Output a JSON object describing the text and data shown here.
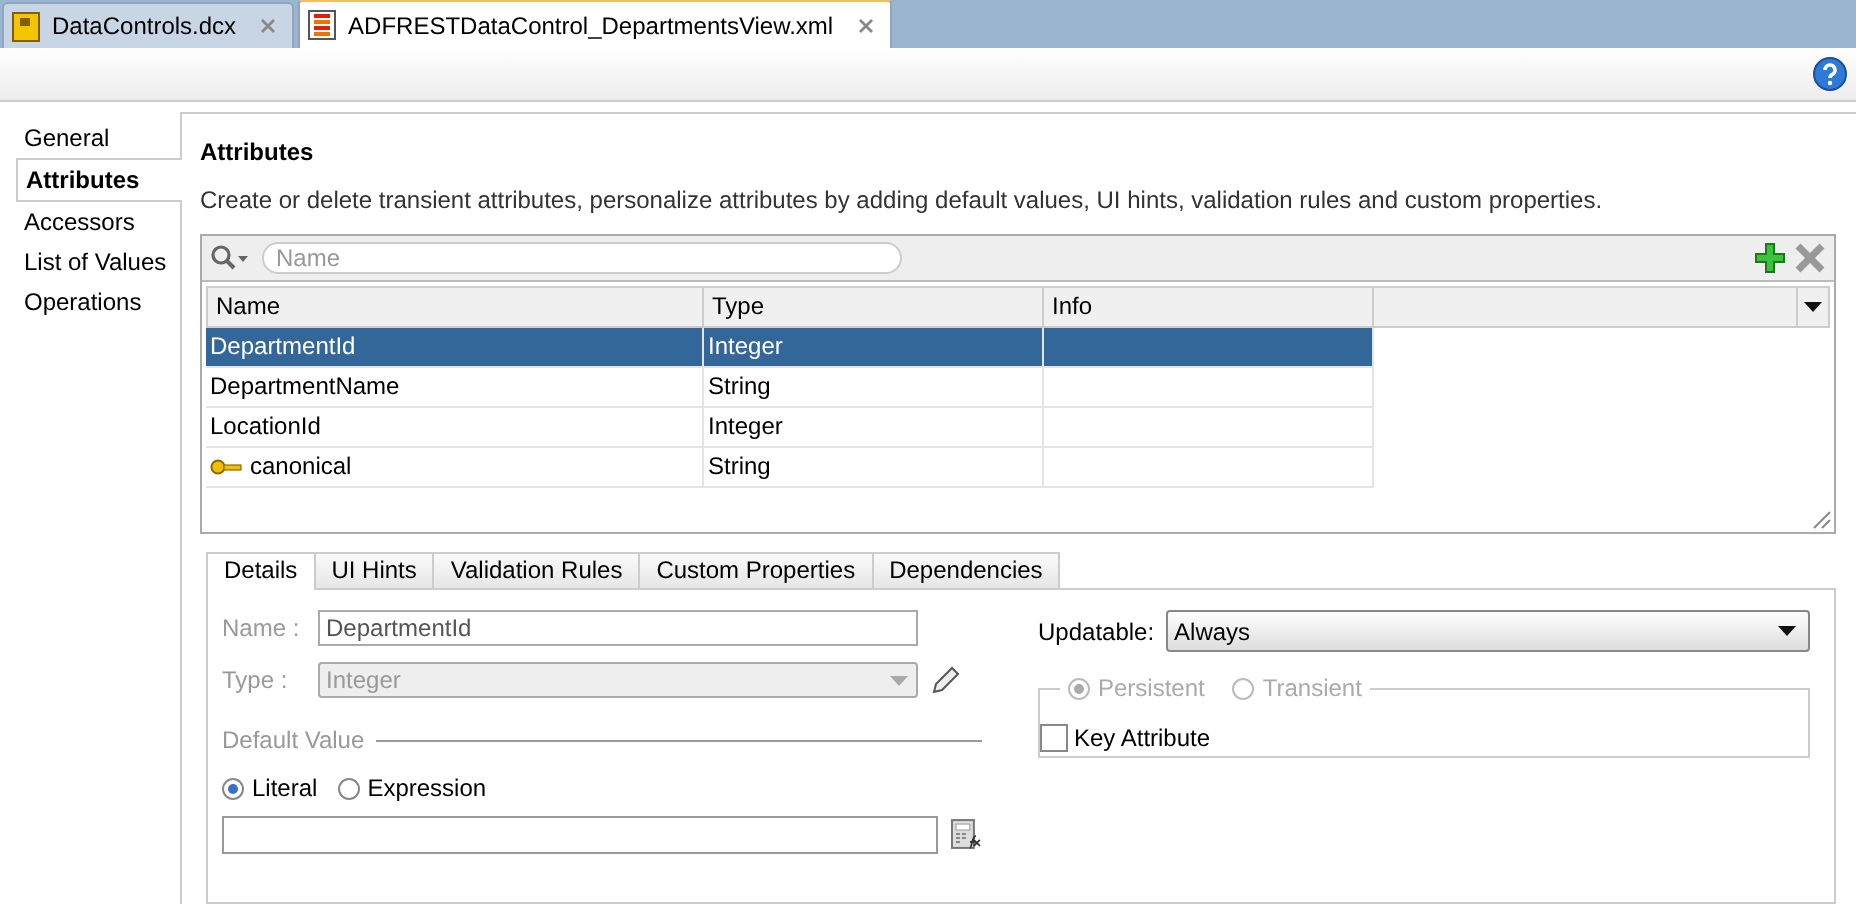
{
  "editor_tabs": [
    {
      "label": "DataControls.dcx",
      "kind": "dcx",
      "selected": false
    },
    {
      "label": "ADFRESTDataControl_DepartmentsView.xml",
      "kind": "xml",
      "selected": true
    }
  ],
  "sidebar": {
    "items": [
      {
        "label": "General",
        "selected": false
      },
      {
        "label": "Attributes",
        "selected": true
      },
      {
        "label": "Accessors",
        "selected": false
      },
      {
        "label": "List of Values",
        "selected": false
      },
      {
        "label": "Operations",
        "selected": false
      }
    ]
  },
  "section": {
    "title": "Attributes",
    "description": "Create or delete transient attributes, personalize attributes by adding default values, UI hints, validation rules and custom properties."
  },
  "search": {
    "placeholder": "Name"
  },
  "table": {
    "columns": [
      "Name",
      "Type",
      "Info"
    ],
    "rows": [
      {
        "name": "DepartmentId",
        "type": "Integer",
        "key": false,
        "selected": true
      },
      {
        "name": "DepartmentName",
        "type": "String",
        "key": false,
        "selected": false
      },
      {
        "name": "LocationId",
        "type": "Integer",
        "key": false,
        "selected": false
      },
      {
        "name": "canonical",
        "type": "String",
        "key": true,
        "selected": false
      }
    ]
  },
  "detail_tabs": [
    {
      "label": "Details",
      "selected": true
    },
    {
      "label": "UI Hints",
      "selected": false
    },
    {
      "label": "Validation Rules",
      "selected": false
    },
    {
      "label": "Custom Properties",
      "selected": false
    },
    {
      "label": "Dependencies",
      "selected": false
    }
  ],
  "details": {
    "name_field": {
      "label": "Name :",
      "value": "DepartmentId"
    },
    "type_field": {
      "label": "Type :",
      "value": "Integer",
      "disabled": true
    },
    "default_value": {
      "legend": "Default Value",
      "options": [
        {
          "label": "Literal",
          "selected": true
        },
        {
          "label": "Expression",
          "selected": false
        }
      ]
    },
    "updatable": {
      "label": "Updatable:",
      "value": "Always"
    },
    "storage": {
      "disabled": true,
      "options": [
        {
          "label": "Persistent",
          "selected": true
        },
        {
          "label": "Transient",
          "selected": false
        }
      ]
    },
    "key_attribute": {
      "label": "Key Attribute",
      "checked": false
    }
  }
}
